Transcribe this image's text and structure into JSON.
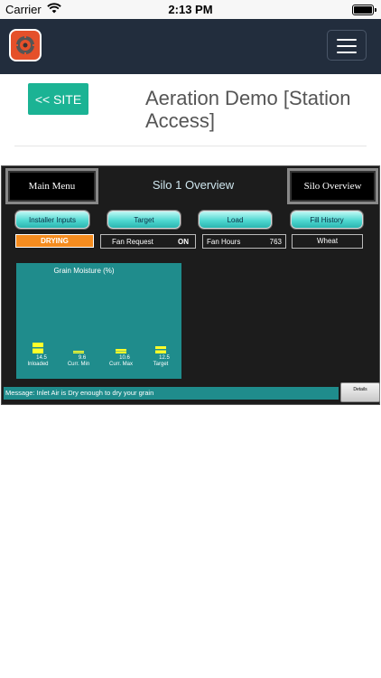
{
  "status_bar": {
    "carrier": "Carrier",
    "time": "2:13 PM"
  },
  "header": {
    "site_button": "<< SITE",
    "title": "Aeration Demo [Station Access]"
  },
  "panel": {
    "main_menu": "Main Menu",
    "silo_overview": "Silo Overview",
    "title": "Silo 1 Overview",
    "tabs": [
      "Installer Inputs",
      "Target",
      "Load",
      "Fill History"
    ],
    "status": "DRYING",
    "fan_request_label": "Fan Request",
    "fan_request_value": "ON",
    "fan_hours_label": "Fan Hours",
    "fan_hours_value": "763",
    "grain_type": "Wheat",
    "message": "Message: Inlet Air is Dry enough to dry your grain",
    "details_button": "Details"
  },
  "moisture": {
    "title": "Grain Moisture (%)",
    "items": [
      {
        "label": "Inloaded",
        "value": "14.5",
        "num": 14.5
      },
      {
        "label": "Curr. Min",
        "value": "9.6",
        "num": 9.6
      },
      {
        "label": "Curr. Max",
        "value": "10.6",
        "num": 10.6
      },
      {
        "label": "Target",
        "value": "12.5",
        "num": 12.5
      }
    ]
  },
  "colors": {
    "navbar": "#222d3d",
    "site_button": "#1bb394",
    "status_drying": "#f58c1f",
    "panel_teal": "#1f8c8c",
    "bar": "#ffff2a"
  }
}
